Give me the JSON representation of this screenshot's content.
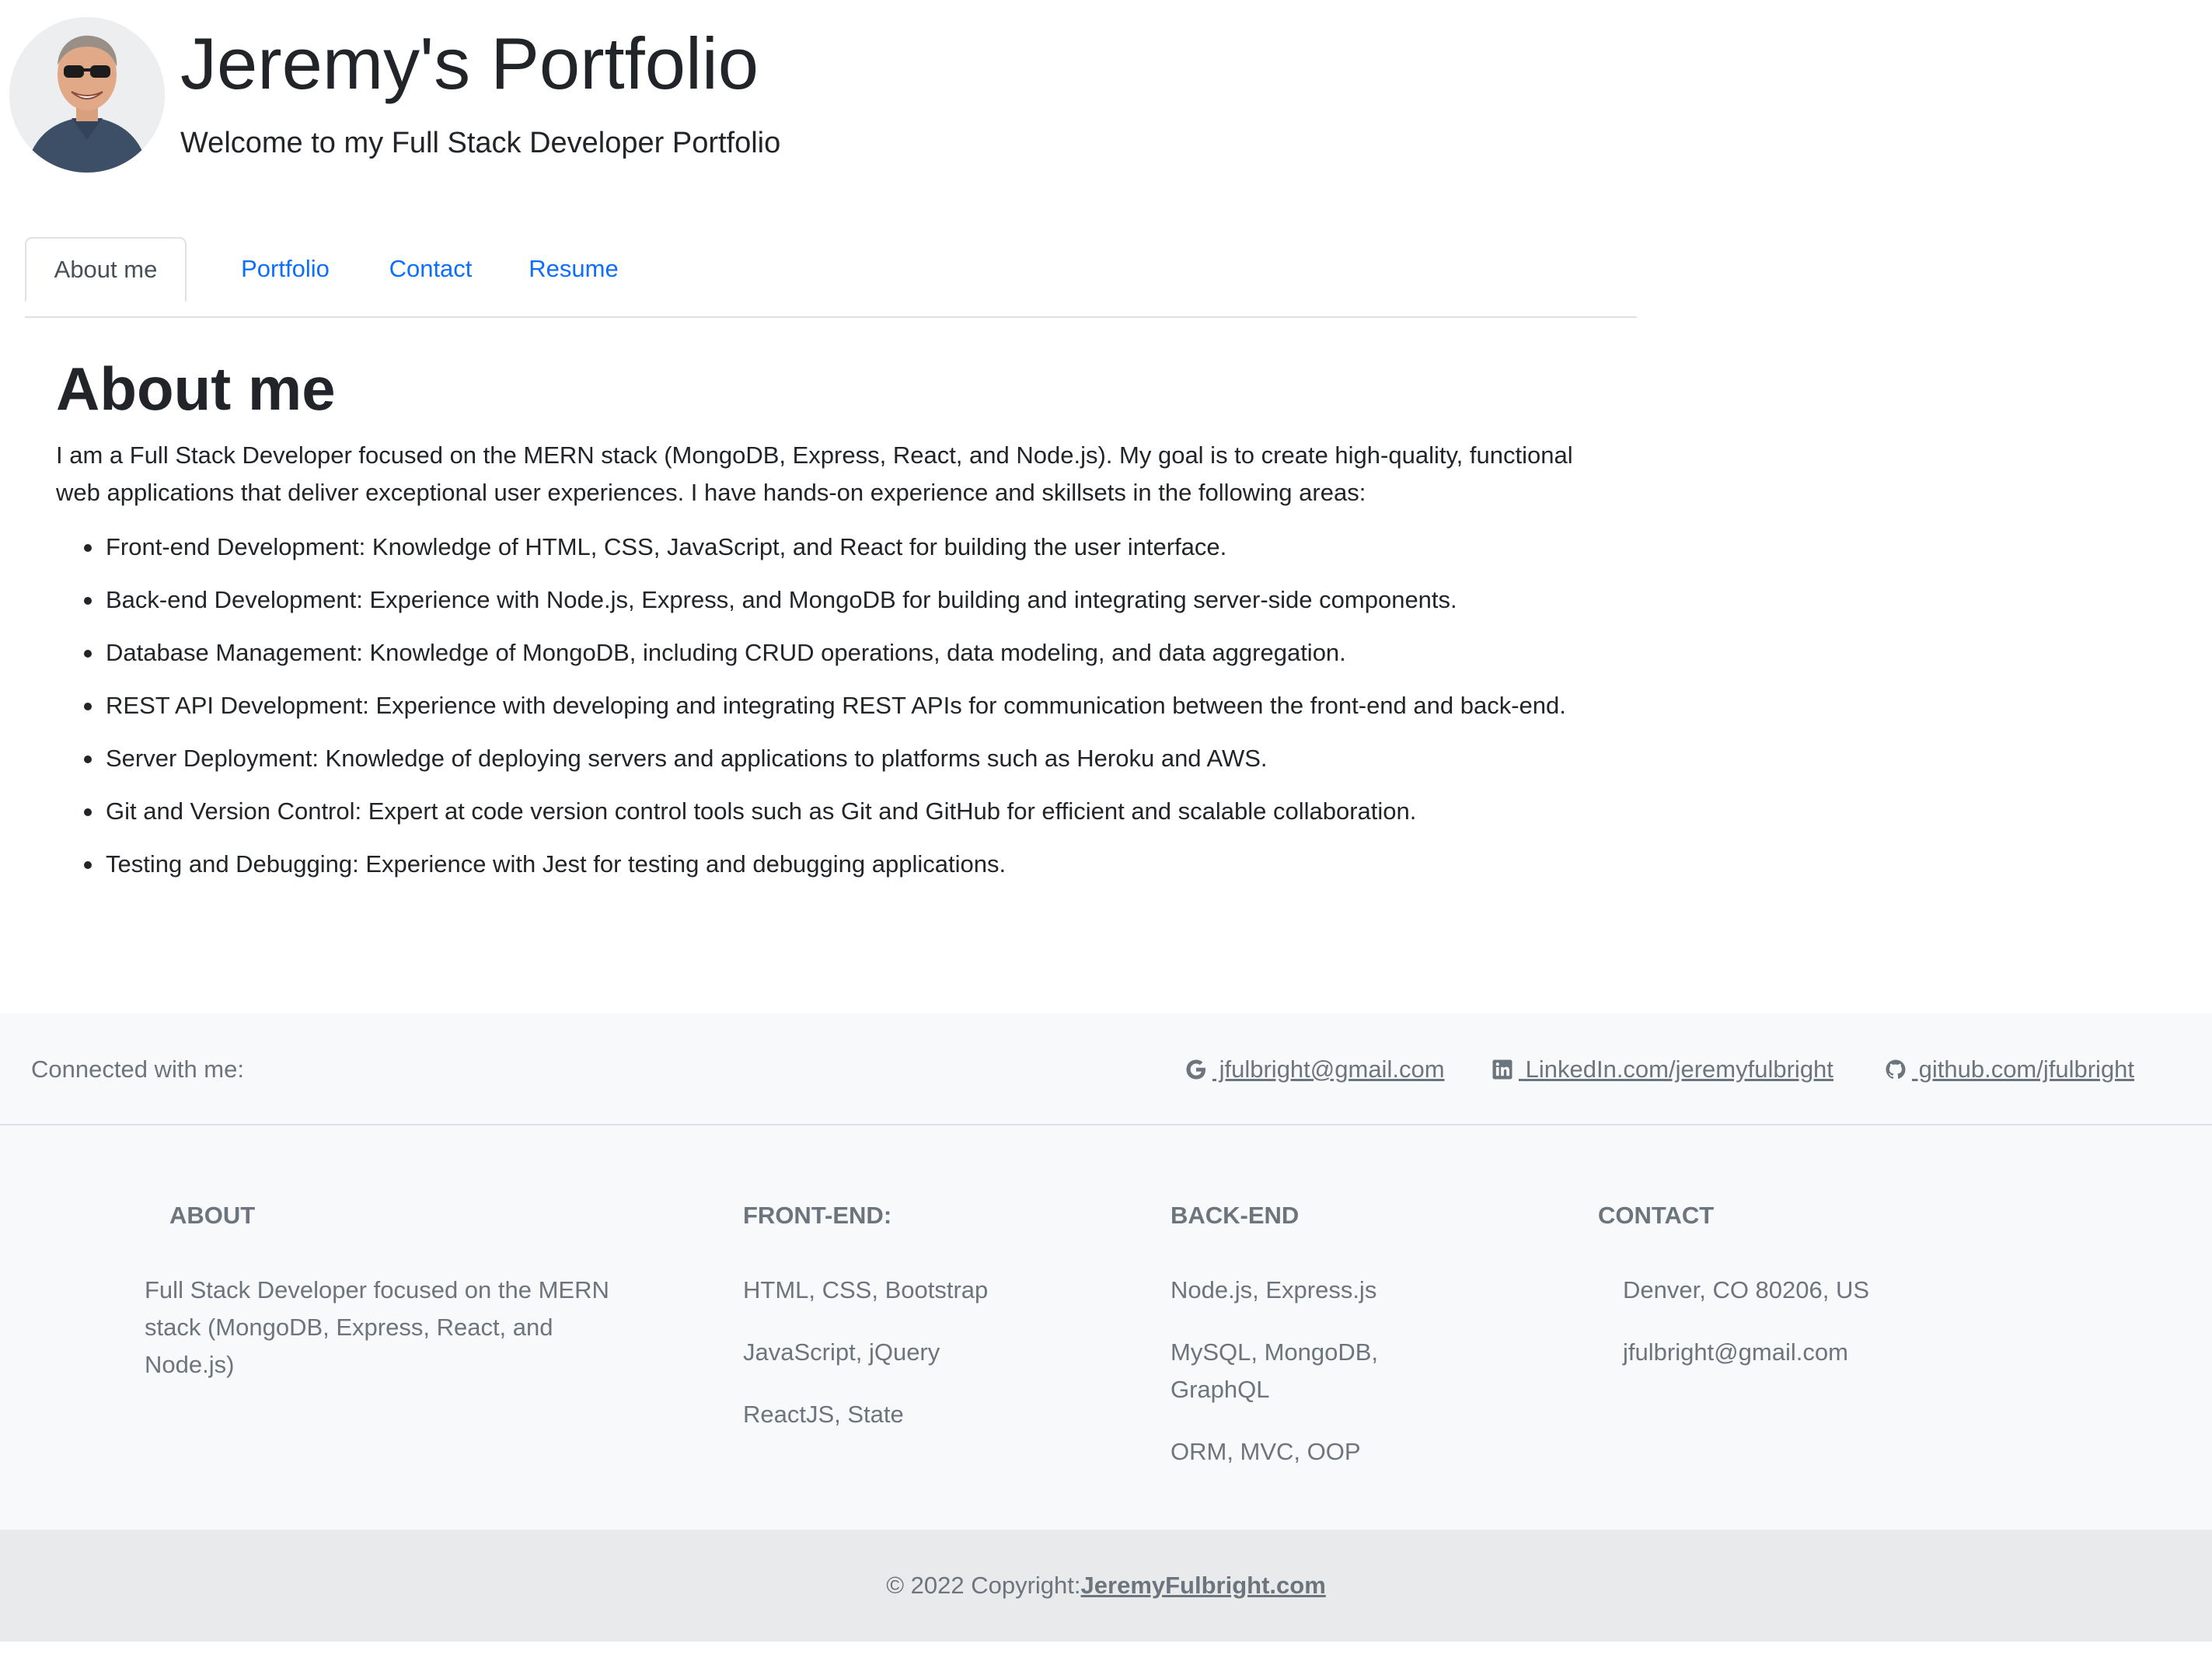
{
  "header": {
    "title": "Jeremy's Portfolio",
    "subtitle": "Welcome to my Full Stack Developer Portfolio"
  },
  "tabs": [
    {
      "label": "About me",
      "active": true
    },
    {
      "label": "Portfolio",
      "active": false
    },
    {
      "label": "Contact",
      "active": false
    },
    {
      "label": "Resume",
      "active": false
    }
  ],
  "about": {
    "heading": "About me",
    "intro": "I am a Full Stack Developer focused on the MERN stack (MongoDB, Express, React, and Node.js). My goal is to create high-quality, functional web applications that deliver exceptional user experiences. I have hands-on experience and skillsets in the following areas:",
    "skills": [
      "Front-end Development: Knowledge of HTML, CSS, JavaScript, and React for building the user interface.",
      "Back-end Development: Experience with Node.js, Express, and MongoDB for building and integrating server-side components.",
      "Database Management: Knowledge of MongoDB, including CRUD operations, data modeling, and data aggregation.",
      "REST API Development: Experience with developing and integrating REST APIs for communication between the front-end and back-end.",
      "Server Deployment: Knowledge of deploying servers and applications to platforms such as Heroku and AWS.",
      "Git and Version Control: Expert at code version control tools such as Git and GitHub for efficient and scalable collaboration.",
      "Testing and Debugging: Experience with Jest for testing and debugging applications."
    ]
  },
  "connect": {
    "label": "Connected with me:",
    "email": " jfulbright@gmail.com",
    "linkedin": " LinkedIn.com/jeremyfulbright",
    "github": " github.com/jfulbright"
  },
  "footer": {
    "about_heading": "ABOUT",
    "about_text": "Full Stack Developer focused on the MERN stack (MongoDB, Express, React, and Node.js)",
    "frontend_heading": "FRONT-END:",
    "frontend_items": [
      "HTML, CSS, Bootstrap",
      "JavaScript, jQuery",
      "ReactJS, State"
    ],
    "backend_heading": "BACK-END",
    "backend_items": [
      "Node.js, Express.js",
      "MySQL, MongoDB, GraphQL",
      "ORM, MVC, OOP"
    ],
    "contact_heading": "CONTACT",
    "contact_items": [
      "Denver, CO 80206, US",
      "jfulbright@gmail.com"
    ]
  },
  "copyright": {
    "prefix": "© 2022 Copyright:",
    "link": "JeremyFulbright.com"
  },
  "colors": {
    "link_blue": "#0d6efd",
    "muted": "#6c757d",
    "footer_bg": "#f8f9fa",
    "copyright_bg": "#e9eaec"
  },
  "icons": {
    "avatar": "profile-photo",
    "email": "google-icon",
    "linkedin": "linkedin-icon",
    "github": "github-icon"
  }
}
